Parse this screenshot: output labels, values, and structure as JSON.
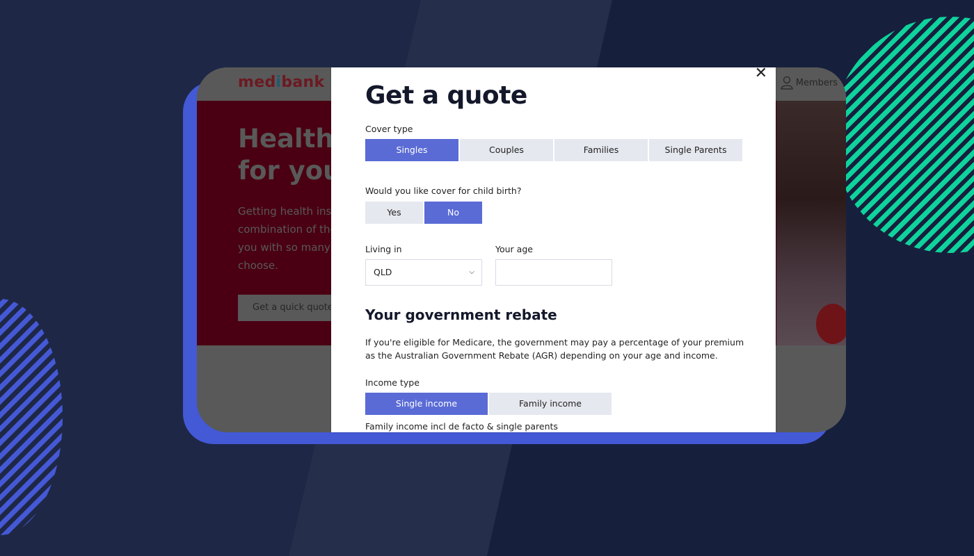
{
  "background": {
    "accent_green": "#0fd39c",
    "accent_blue": "#4359d6",
    "base": "#1e2846"
  },
  "site": {
    "logo_prefix": "med",
    "logo_i": "i",
    "logo_suffix": "bank",
    "members_label": "Members",
    "hero_title_line1": "Health i",
    "hero_title_line2": "for you",
    "hero_text_lines": [
      "Getting health insu",
      "combination of the",
      "you with so many g",
      "choose."
    ],
    "hero_button": "Get a quick quote"
  },
  "modal": {
    "title": "Get a quote",
    "close_label": "✕",
    "cover_type": {
      "label": "Cover type",
      "options": [
        "Singles",
        "Couples",
        "Families",
        "Single Parents"
      ],
      "selected": "Singles"
    },
    "child_birth": {
      "label": "Would you like cover for child birth?",
      "options": [
        "Yes",
        "No"
      ],
      "selected": "No"
    },
    "living_in": {
      "label": "Living in",
      "value": "QLD"
    },
    "age": {
      "label": "Your age",
      "value": "",
      "placeholder": ""
    },
    "rebate": {
      "heading": "Your government rebate",
      "description": "If you're eligible for Medicare, the government may pay a percentage of your premium as the Australian Government Rebate (AGR) depending on your age and income.",
      "income_type_label": "Income type",
      "income_options": [
        "Single income",
        "Family income"
      ],
      "income_selected": "Single income",
      "family_note": "Family income incl de facto & single parents"
    },
    "colors": {
      "active": "#5a6bd6",
      "inactive": "#e6e8ef"
    }
  }
}
